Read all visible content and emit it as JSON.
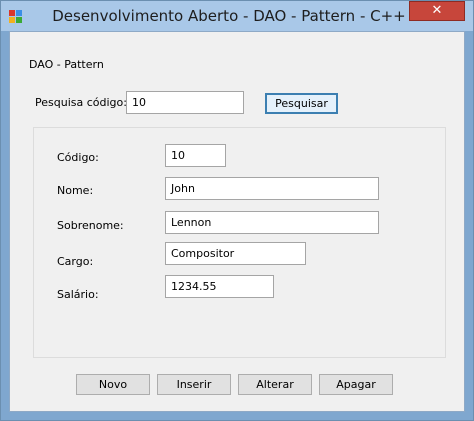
{
  "window": {
    "title": "Desenvolvimento Aberto - DAO - Pattern - C++",
    "close_label": "✕"
  },
  "header": {
    "label": "DAO - Pattern"
  },
  "search": {
    "label": "Pesquisa código:",
    "value": "10",
    "button_label": "Pesquisar"
  },
  "form": {
    "codigo_label": "Código:",
    "codigo_value": "10",
    "nome_label": "Nome:",
    "nome_value": "John",
    "sobrenome_label": "Sobrenome:",
    "sobrenome_value": "Lennon",
    "cargo_label": "Cargo:",
    "cargo_value": "Compositor",
    "salario_label": "Salário:",
    "salario_value": "1234.55"
  },
  "actions": {
    "novo": "Novo",
    "inserir": "Inserir",
    "alterar": "Alterar",
    "apagar": "Apagar"
  },
  "colors": {
    "title_bar": "#a9c8e8",
    "close_button": "#c7463b",
    "client_bg": "#f0f0f0"
  }
}
